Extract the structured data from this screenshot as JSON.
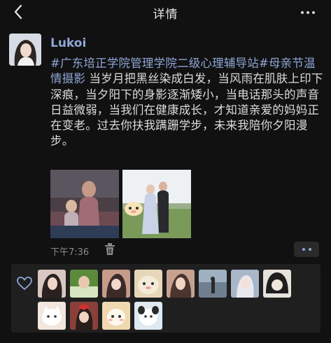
{
  "header": {
    "title": "详情",
    "back_icon": "chevron-left-icon",
    "more_icon": "more-icon"
  },
  "post": {
    "username": "Lukoi",
    "hashtag": "#广东培正学院管理学院二级心理辅导站#母亲节温情摄影",
    "text": " 当岁月把黑丝染成白发，当风雨在肌肤上印下深痕，当夕阳下的身影逐渐矮小，当电话那头的声音日益微弱，当我们在健康成长，才知道亲爱的妈妈正在变老。过去你扶我蹒跚学步，未来我陪你夕阳漫步。",
    "time": "下午7:36",
    "photos": [
      "photo-mother-child",
      "photo-two-women-outdoor"
    ],
    "delete_icon": "trash-icon",
    "options_icon": "more-icon"
  },
  "likes": {
    "icon": "heart-icon",
    "avatars": [
      {
        "name": "avatar-1",
        "color": "#d8c7c0"
      },
      {
        "name": "avatar-2",
        "color": "#5a8a3a"
      },
      {
        "name": "avatar-3",
        "color": "#c79b8a"
      },
      {
        "name": "avatar-4",
        "color": "#e8d6b8"
      },
      {
        "name": "avatar-5",
        "color": "#c7a190"
      },
      {
        "name": "avatar-6",
        "color": "#6f7f90"
      },
      {
        "name": "avatar-7",
        "color": "#a9b6c8"
      },
      {
        "name": "avatar-8",
        "color": "#3a3a3a"
      },
      {
        "name": "avatar-9",
        "color": "#f3e7dd"
      },
      {
        "name": "avatar-10",
        "color": "#8a3f3a"
      },
      {
        "name": "avatar-11",
        "color": "#f0d9b0"
      },
      {
        "name": "avatar-12",
        "color": "#dfe9f2"
      }
    ]
  }
}
